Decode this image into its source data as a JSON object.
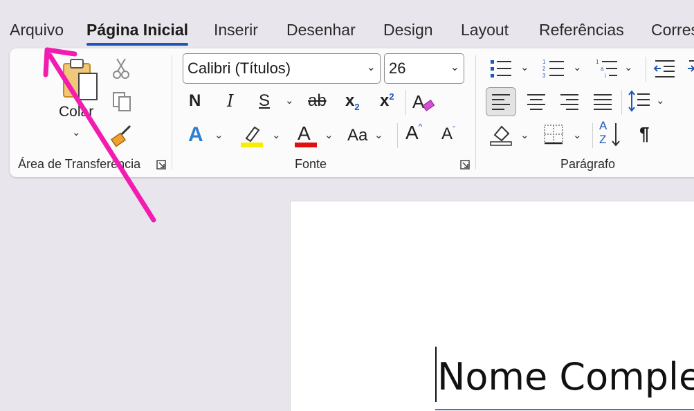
{
  "menu": {
    "tabs": [
      {
        "label": "Arquivo"
      },
      {
        "label": "Página Inicial",
        "active": true
      },
      {
        "label": "Inserir"
      },
      {
        "label": "Desenhar"
      },
      {
        "label": "Design"
      },
      {
        "label": "Layout"
      },
      {
        "label": "Referências"
      },
      {
        "label": "Corres"
      }
    ]
  },
  "ribbon": {
    "clipboard": {
      "paste_label": "Colar",
      "group_label": "Área de Transferência",
      "icons": [
        "paste-icon",
        "cut-icon",
        "copy-icon",
        "format-painter-icon"
      ]
    },
    "font": {
      "font_name": "Calibri (Títulos)",
      "font_size": "26",
      "bold": "N",
      "italic": "I",
      "underline": "S",
      "strike": "ab",
      "subscript": "x",
      "subscript_mark": "2",
      "superscript": "x",
      "superscript_mark": "2",
      "text_effects": "A",
      "font_color": "A",
      "change_case": "Aa",
      "grow": "A",
      "shrink": "A",
      "group_label": "Fonte",
      "highlight_color": "#f5ee00",
      "font_color_swatch": "#e01010"
    },
    "paragraph": {
      "group_label": "Parágrafo",
      "pilcrow": "¶",
      "sort_top": "A",
      "sort_bottom": "Z"
    }
  },
  "document": {
    "visible_text": "Nome Comple"
  },
  "colors": {
    "accent": "#1f55b5",
    "annotation_arrow": "#f21cb0"
  }
}
